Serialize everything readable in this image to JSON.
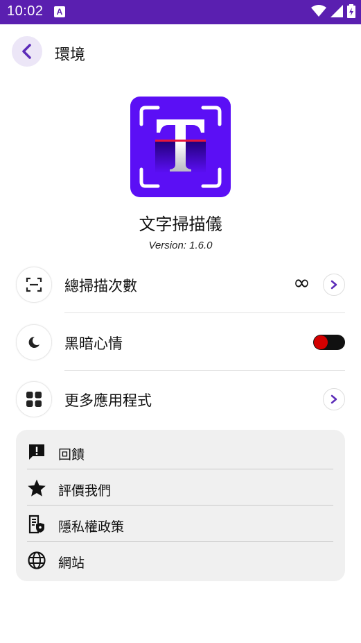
{
  "status_bar": {
    "time": "10:02",
    "notification_icon": "A"
  },
  "app_bar": {
    "title": "環境"
  },
  "app": {
    "name": "文字掃描儀",
    "version": "Version: 1.6.0",
    "logo_letter": "T",
    "brand_color": "#5b0ff5"
  },
  "rows": {
    "scan_count": {
      "label": "總掃描次數",
      "value": "∞"
    },
    "dark_mode": {
      "label": "黑暗心情",
      "enabled": false
    },
    "more_apps": {
      "label": "更多應用程式"
    }
  },
  "links": [
    {
      "label": "回饋",
      "icon": "feedback-icon"
    },
    {
      "label": "評價我們",
      "icon": "star-icon"
    },
    {
      "label": "隱私權政策",
      "icon": "privacy-policy-icon"
    },
    {
      "label": "網站",
      "icon": "globe-icon"
    }
  ],
  "colors": {
    "status_bar": "#5a1fb0",
    "accent": "#5b2bb8",
    "toggle_knob": "#d40000"
  }
}
